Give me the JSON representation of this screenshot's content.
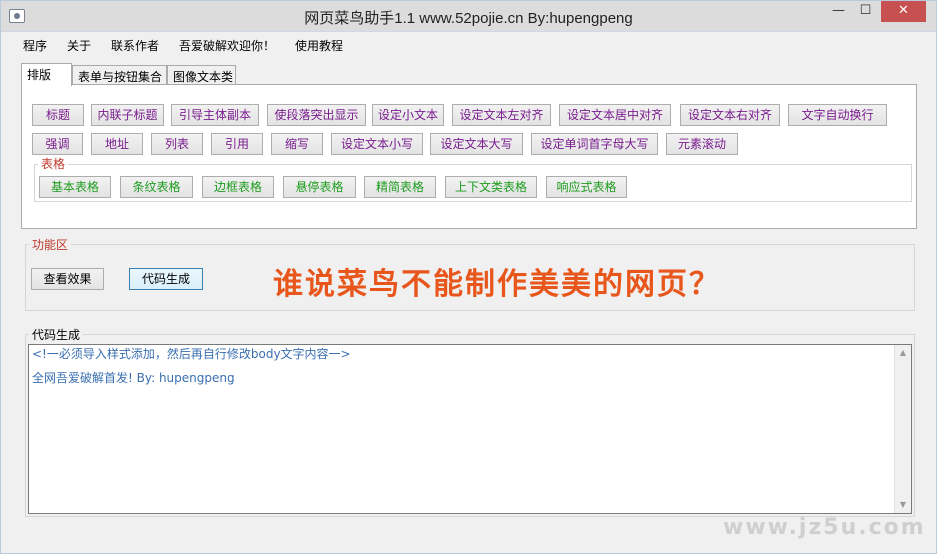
{
  "window": {
    "title": "网页菜鸟助手1.1     www.52pojie.cn By:hupengpeng",
    "minimize_label": "—",
    "maximize_label": "☐",
    "close_label": "✕"
  },
  "menu": {
    "items": [
      {
        "label": "程序"
      },
      {
        "label": "关于"
      },
      {
        "label": "联系作者"
      },
      {
        "label": "吾爱破解欢迎你！"
      },
      {
        "label": "使用教程"
      }
    ]
  },
  "tabs": [
    {
      "label": "排版"
    },
    {
      "label": "表单与按钮集合"
    },
    {
      "label": "图像文本类"
    }
  ],
  "format_buttons_row1": [
    {
      "label": "标题"
    },
    {
      "label": "内联子标题"
    },
    {
      "label": "引导主体副本"
    },
    {
      "label": "使段落突出显示"
    },
    {
      "label": "设定小文本"
    },
    {
      "label": "设定文本左对齐"
    },
    {
      "label": "设定文本居中对齐"
    },
    {
      "label": "设定文本右对齐"
    },
    {
      "label": "文字自动换行"
    }
  ],
  "format_buttons_row2": [
    {
      "label": "强调"
    },
    {
      "label": "地址"
    },
    {
      "label": "列表"
    },
    {
      "label": "引用"
    },
    {
      "label": "缩写"
    },
    {
      "label": "设定文本小写"
    },
    {
      "label": "设定文本大写"
    },
    {
      "label": "设定单词首字母大写"
    },
    {
      "label": "元素滚动"
    }
  ],
  "table_group": {
    "label": "表格",
    "buttons": [
      {
        "label": "基本表格"
      },
      {
        "label": "条纹表格"
      },
      {
        "label": "边框表格"
      },
      {
        "label": "悬停表格"
      },
      {
        "label": "精简表格"
      },
      {
        "label": "上下文类表格"
      },
      {
        "label": "响应式表格"
      }
    ]
  },
  "function_area": {
    "label": "功能区",
    "preview_button": "查看效果",
    "generate_button": "代码生成",
    "slogan": "谁说菜鸟不能制作美美的网页？"
  },
  "code_area": {
    "label": "代码生成",
    "line1": "<!一必须导入样式添加，然后再自行修改body文字内容一>",
    "line2": "全网吾爱破解首发! By: hupengpeng"
  },
  "watermark": "www.jz5u.com",
  "colors": {
    "format_button_text": "#7a1c8e",
    "table_button_text": "#1e9c1e",
    "group_label": "#c0392b",
    "slogan": "#e8561c",
    "code_text": "#3a6fb0"
  }
}
